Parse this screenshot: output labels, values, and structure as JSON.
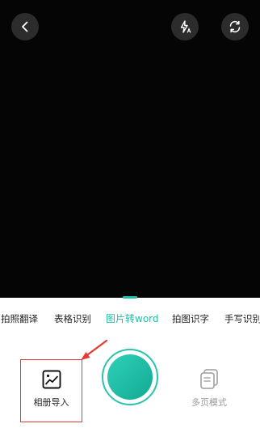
{
  "toolbar": {
    "back_icon": "chevron-left-icon",
    "flash_icon": "flash-auto-icon",
    "flip_icon": "switch-camera-icon"
  },
  "modes": [
    {
      "label": "拍照翻译",
      "active": false
    },
    {
      "label": "表格识别",
      "active": false
    },
    {
      "label": "图片转word",
      "active": true
    },
    {
      "label": "拍图识字",
      "active": false
    },
    {
      "label": "手写识别",
      "active": false
    }
  ],
  "bottom": {
    "album_label": "相册导入",
    "multi_page_label": "多页模式"
  },
  "colors": {
    "accent": "#1fbfa6",
    "highlight_box": "#e53935"
  }
}
